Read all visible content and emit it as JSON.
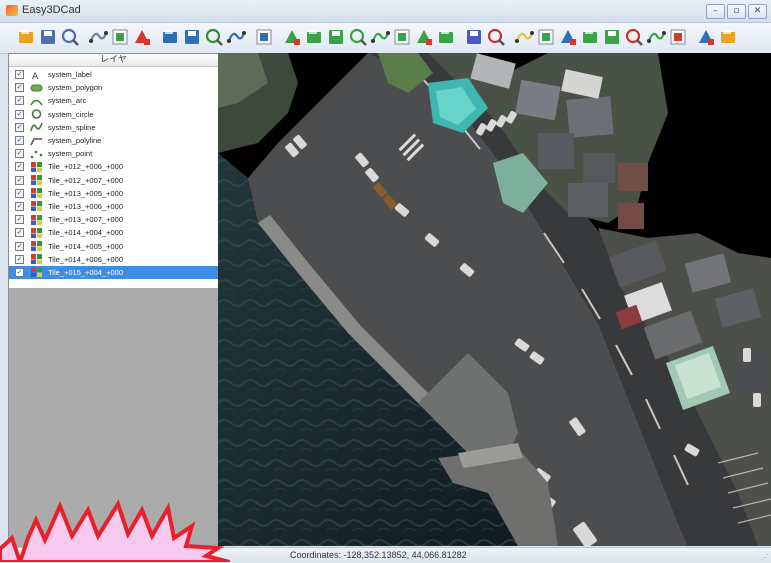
{
  "window": {
    "title": "Easy3DCad",
    "minimize": "–",
    "restore": "▫",
    "close": "✕"
  },
  "toolbar": {
    "tools": [
      {
        "name": "open-icon",
        "color": "#e8a423"
      },
      {
        "name": "save-icon",
        "color": "#4d6fb0"
      },
      {
        "name": "save-as-icon",
        "color": "#4d6fb0"
      },
      {
        "name": "export-icon",
        "color": "#6b7fa3"
      },
      {
        "name": "add-layer-icon",
        "color": "#3aa34a"
      },
      {
        "name": "delete-layer-icon",
        "color": "#d33a2c"
      },
      {
        "name": "zoom-in-icon",
        "color": "#2f6fb8"
      },
      {
        "name": "zoom-out-icon",
        "color": "#2f6fb8"
      },
      {
        "name": "zoom-fit-icon",
        "color": "#2f8f3a"
      },
      {
        "name": "pan-icon",
        "color": "#2f6fb8"
      },
      {
        "name": "undo-icon",
        "color": "#2f6fb8"
      },
      {
        "name": "draw-points-icon",
        "color": "#3aa34a"
      },
      {
        "name": "draw-polyline-icon",
        "color": "#3aa34a"
      },
      {
        "name": "draw-spline-icon",
        "color": "#3aa34a"
      },
      {
        "name": "draw-polygon-icon",
        "color": "#3aa34a"
      },
      {
        "name": "draw-arc-icon",
        "color": "#3aa34a"
      },
      {
        "name": "draw-curve-icon",
        "color": "#3aa34a"
      },
      {
        "name": "label-icon",
        "color": "#3aa34a"
      },
      {
        "name": "snap-icon",
        "color": "#3aa34a"
      },
      {
        "name": "3d-box-icon",
        "color": "#4b59c8"
      },
      {
        "name": "measure-icon",
        "color": "#c8352b"
      },
      {
        "name": "select-icon",
        "color": "#e8c43a"
      },
      {
        "name": "edit-vertex-icon",
        "color": "#3aa34a"
      },
      {
        "name": "move-icon",
        "color": "#2f6fb8"
      },
      {
        "name": "rotate-icon",
        "color": "#3aa34a"
      },
      {
        "name": "offset-icon",
        "color": "#3aa34a"
      },
      {
        "name": "trim-icon",
        "color": "#c8352b"
      },
      {
        "name": "extend-icon",
        "color": "#3aa34a"
      },
      {
        "name": "erase-icon",
        "color": "#d33a2c"
      },
      {
        "name": "import-icon",
        "color": "#2f6fb8"
      },
      {
        "name": "settings-icon",
        "color": "#e8a423"
      }
    ]
  },
  "layers": {
    "header": "レイヤ",
    "items": [
      {
        "label": "system_label",
        "icon": "label-icon",
        "checked": true,
        "selected": false
      },
      {
        "label": "system_polygon",
        "icon": "polygon-icon",
        "checked": true,
        "selected": false
      },
      {
        "label": "system_arc",
        "icon": "arc-icon",
        "checked": true,
        "selected": false
      },
      {
        "label": "system_circle",
        "icon": "circle-icon",
        "checked": true,
        "selected": false
      },
      {
        "label": "system_spline",
        "icon": "spline-icon",
        "checked": true,
        "selected": false
      },
      {
        "label": "system_polyline",
        "icon": "polyline-icon",
        "checked": true,
        "selected": false
      },
      {
        "label": "system_point",
        "icon": "point-icon",
        "checked": true,
        "selected": false
      },
      {
        "label": "Tile_+012_+006_+000",
        "icon": "tile-icon",
        "checked": true,
        "selected": false
      },
      {
        "label": "Tile_+012_+007_+000",
        "icon": "tile-icon",
        "checked": true,
        "selected": false
      },
      {
        "label": "Tile_+013_+005_+000",
        "icon": "tile-icon",
        "checked": true,
        "selected": false
      },
      {
        "label": "Tile_+013_+006_+000",
        "icon": "tile-icon",
        "checked": true,
        "selected": false
      },
      {
        "label": "Tile_+013_+007_+000",
        "icon": "tile-icon",
        "checked": true,
        "selected": false
      },
      {
        "label": "Tile_+014_+004_+000",
        "icon": "tile-icon",
        "checked": true,
        "selected": false
      },
      {
        "label": "Tile_+014_+005_+000",
        "icon": "tile-icon",
        "checked": true,
        "selected": false
      },
      {
        "label": "Tile_+014_+006_+000",
        "icon": "tile-icon",
        "checked": true,
        "selected": false
      },
      {
        "label": "Tile_+015_+004_+000",
        "icon": "tile-icon",
        "checked": true,
        "selected": true
      }
    ]
  },
  "status": {
    "coordinates": "Coordinates:  -128,352.13852, 44,066.81282"
  },
  "colors": {
    "selection": "#3d8de6",
    "burst_fill": "#f8c9ef",
    "burst_stroke": "#e8202a"
  }
}
